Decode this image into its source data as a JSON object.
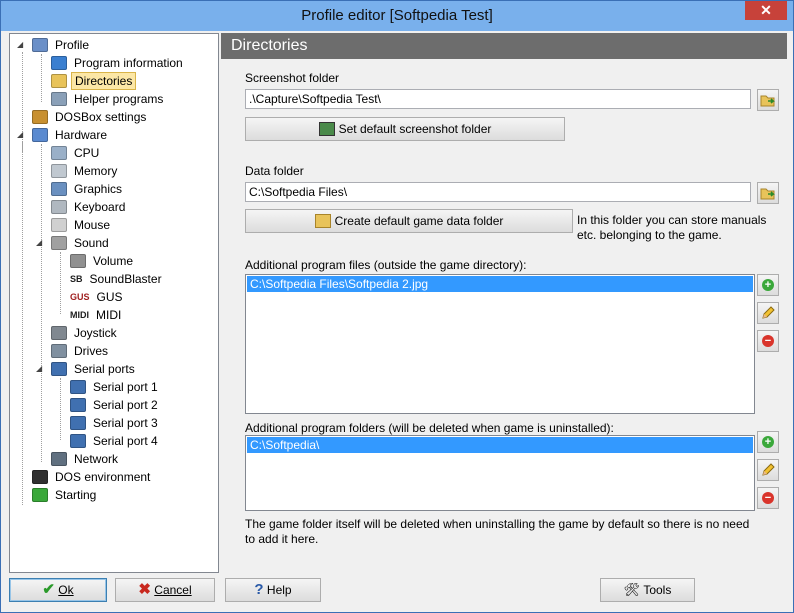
{
  "window": {
    "title": "Profile editor [Softpedia Test]",
    "close_glyph": "✕"
  },
  "tree": [
    {
      "label": "Profile",
      "icon": "profile-icon"
    },
    {
      "label": "Program information",
      "icon": "info-icon"
    },
    {
      "label": "Directories",
      "icon": "folder-icon",
      "selected": true
    },
    {
      "label": "Helper programs",
      "icon": "helper-programs-icon"
    },
    {
      "label": "DOSBox settings",
      "icon": "dosbox-icon"
    },
    {
      "label": "Hardware",
      "icon": "hardware-icon"
    },
    {
      "label": "CPU",
      "icon": "cpu-icon"
    },
    {
      "label": "Memory",
      "icon": "memory-icon"
    },
    {
      "label": "Graphics",
      "icon": "graphics-icon"
    },
    {
      "label": "Keyboard",
      "icon": "keyboard-icon"
    },
    {
      "label": "Mouse",
      "icon": "mouse-icon"
    },
    {
      "label": "Sound",
      "icon": "sound-icon"
    },
    {
      "label": "Volume",
      "icon": "volume-icon"
    },
    {
      "label": "SoundBlaster",
      "icon": "soundblaster-icon",
      "badge": "SB"
    },
    {
      "label": "GUS",
      "icon": "gus-icon",
      "badge": "GUS"
    },
    {
      "label": "MIDI",
      "icon": "midi-icon",
      "badge": "MIDI"
    },
    {
      "label": "Joystick",
      "icon": "joystick-icon"
    },
    {
      "label": "Drives",
      "icon": "drives-icon"
    },
    {
      "label": "Serial ports",
      "icon": "serial-ports-icon"
    },
    {
      "label": "Serial port 1",
      "icon": "serial-port-icon"
    },
    {
      "label": "Serial port 2",
      "icon": "serial-port-icon"
    },
    {
      "label": "Serial port 3",
      "icon": "serial-port-icon"
    },
    {
      "label": "Serial port 4",
      "icon": "serial-port-icon"
    },
    {
      "label": "Network",
      "icon": "network-icon"
    },
    {
      "label": "DOS environment",
      "icon": "dos-environment-icon"
    },
    {
      "label": "Starting",
      "icon": "starting-icon"
    }
  ],
  "pane": {
    "header": "Directories",
    "screenshot_label": "Screenshot folder",
    "screenshot_value": ".\\Capture\\Softpedia Test\\",
    "set_default_screenshot": "Set default screenshot folder",
    "data_label": "Data folder",
    "data_value": "C:\\Softpedia Files\\",
    "create_data_folder": "Create default game data folder",
    "data_hint": "In this folder you can store manuals etc. belonging to the game.",
    "files_label": "Additional program files (outside the game directory):",
    "files_items": [
      "C:\\Softpedia Files\\Softpedia 2.jpg"
    ],
    "folders_label": "Additional program folders (will be deleted when game is uninstalled):",
    "folders_items": [
      "C:\\Softpedia\\"
    ],
    "note": "The game folder itself will be deleted when uninstalling the game by default so there is no need to add it here."
  },
  "buttons": {
    "ok": "Ok",
    "cancel": "Cancel",
    "help": "Help",
    "tools": "Tools",
    "help_glyph": "?",
    "add_glyph": "+",
    "remove_glyph": "−"
  },
  "colors": {
    "selection": "#3399ff",
    "header": "#6d6d6d",
    "titlebar": "#79b0ec"
  }
}
